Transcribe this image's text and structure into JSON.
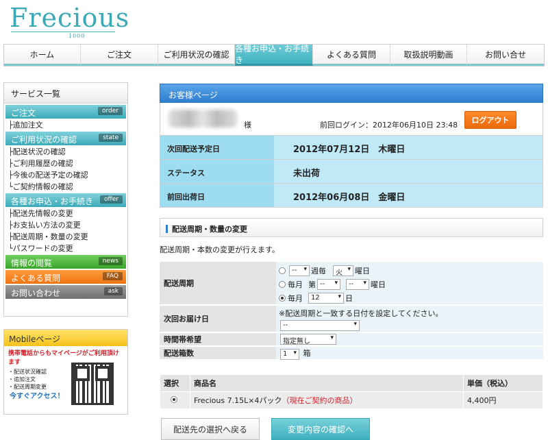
{
  "logo": {
    "word": "Frecious",
    "number": "1000"
  },
  "nav": [
    {
      "label": "ホーム",
      "active": false
    },
    {
      "label": "ご注文",
      "active": false
    },
    {
      "label": "ご利用状況の確認",
      "active": false
    },
    {
      "label": "各種お申込・お手続き",
      "active": true
    },
    {
      "label": "よくある質問",
      "active": false
    },
    {
      "label": "取扱説明動画",
      "active": false
    },
    {
      "label": "お問い合せ",
      "active": false
    }
  ],
  "sidebar": {
    "title": "サービス一覧",
    "cat_order": {
      "label": "ご注文",
      "tag": "order"
    },
    "order_items": [
      "追加注文"
    ],
    "cat_state": {
      "label": "ご利用状況の確認",
      "tag": "state"
    },
    "state_items": [
      "配送状況の確認",
      "ご利用履歴の確認",
      "今後の配送予定の確認",
      "ご契約情報の確認"
    ],
    "cat_offer": {
      "label": "各種お申込・お手続き",
      "tag": "offer"
    },
    "offer_items": [
      "配送先情報の変更",
      "お支払い方法の変更",
      "配送周期・数量の変更",
      "パスワードの変更"
    ],
    "cat_news": {
      "label": "情報の閲覧",
      "tag": "news"
    },
    "cat_faq": {
      "label": "よくある質問",
      "tag": "FAQ"
    },
    "cat_ask": {
      "label": "お問い合わせ",
      "tag": "ask"
    }
  },
  "mobile": {
    "title": "Mobileページ",
    "notice": "携帯電話からもマイページがご利用頂けます",
    "items": [
      "・配送状況確認",
      "・追加注文",
      "・配送周期変更"
    ],
    "access": "今すぐアクセス！"
  },
  "customer": {
    "title": "お客様ページ",
    "suffix": "様",
    "last_login": "前回ログイン：2012年06月10日 23:48",
    "logout": "ログアウト",
    "rows": [
      {
        "key": "次回配送予定日",
        "value": "2012年07月12日　木曜日"
      },
      {
        "key": "ステータス",
        "value": "未出荷"
      },
      {
        "key": "前回出荷日",
        "value": "2012年06月08日　金曜日"
      }
    ]
  },
  "section": {
    "title": "配送周期・数量の変更",
    "desc": "配送周期・本数の変更が行えます。"
  },
  "form": {
    "cycle_label": "配送周期",
    "opt1": {
      "sel1": "--",
      "text1": "週毎",
      "sel2": "火",
      "text2": "曜日"
    },
    "opt2": {
      "text0": "毎月",
      "text1": "第",
      "sel1": "--",
      "sel2": "--",
      "text2": "曜日"
    },
    "opt3": {
      "text0": "毎月",
      "sel1": "12",
      "text1": "日"
    },
    "next_label": "次回お届け日",
    "next_note": "※配送周期と一致する日付を設定してください。",
    "next_sel": "--",
    "time_label": "時間帯希望",
    "time_sel": "指定無し",
    "qty_label": "配送箱数",
    "qty_sel": "1",
    "qty_unit": "箱"
  },
  "product_table": {
    "headers": [
      "選択",
      "商品名",
      "単価（税込）"
    ],
    "name": "Frecious 7.15L×4パック",
    "current": "（現在ご契約の商品）",
    "price": "4,400円"
  },
  "buttons": {
    "back": "配送先の選択へ戻る",
    "confirm": "変更内容の確認へ"
  }
}
